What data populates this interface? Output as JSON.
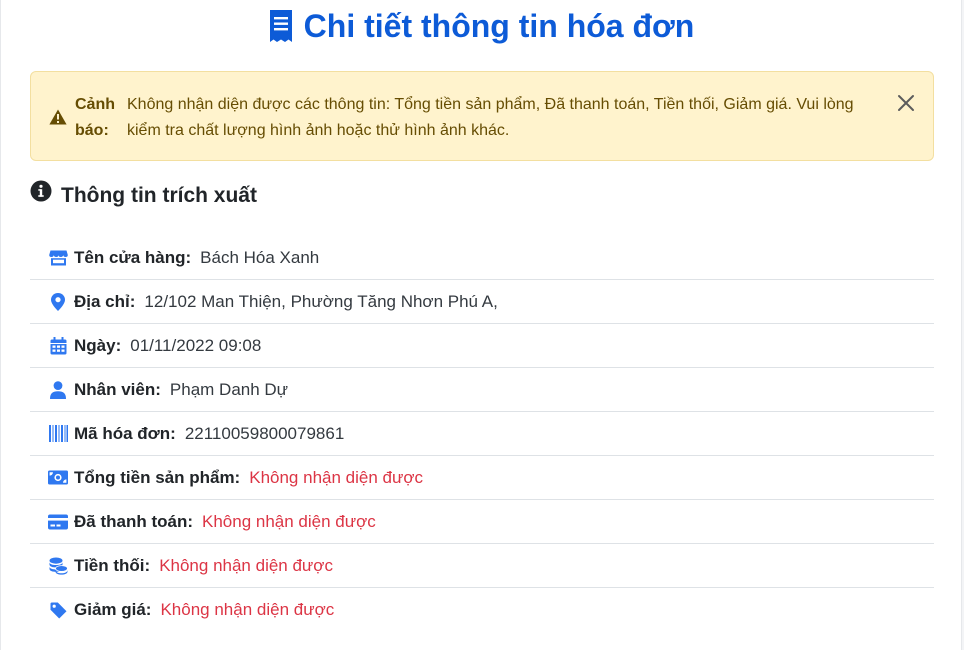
{
  "header": {
    "title": "Chi tiết thông tin hóa đơn",
    "icon": "receipt-icon"
  },
  "alert": {
    "label": "Cảnh báo:",
    "message": "Không nhận diện được các thông tin: Tổng tiền sản phẩm, Đã thanh toán, Tiền thối, Giảm giá. Vui lòng kiểm tra chất lượng hình ảnh hoặc thử hình ảnh khác.",
    "icon": "warning-triangle-icon",
    "close_icon": "close-icon"
  },
  "section": {
    "title": "Thông tin trích xuất",
    "icon": "info-circle-icon"
  },
  "fields": [
    {
      "icon": "store-icon",
      "label": "Tên cửa hàng:",
      "value": "Bách Hóa Xanh",
      "recognized": true
    },
    {
      "icon": "map-pin-icon",
      "label": "Địa chỉ:",
      "value": "12/102 Man Thiện, Phường Tăng Nhơn Phú A,",
      "recognized": true
    },
    {
      "icon": "calendar-icon",
      "label": "Ngày:",
      "value": "01/11/2022 09:08",
      "recognized": true
    },
    {
      "icon": "user-icon",
      "label": "Nhân viên:",
      "value": "Phạm Danh Dự",
      "recognized": true
    },
    {
      "icon": "barcode-icon",
      "label": "Mã hóa đơn:",
      "value": "22110059800079861",
      "recognized": true
    },
    {
      "icon": "money-bill-icon",
      "label": "Tổng tiền sản phẩm:",
      "value": "Không nhận diện được",
      "recognized": false
    },
    {
      "icon": "credit-card-icon",
      "label": "Đã thanh toán:",
      "value": "Không nhận diện được",
      "recognized": false
    },
    {
      "icon": "coins-icon",
      "label": "Tiền thối:",
      "value": "Không nhận diện được",
      "recognized": false
    },
    {
      "icon": "tag-icon",
      "label": "Giảm giá:",
      "value": "Không nhận diện được",
      "recognized": false
    }
  ],
  "colors": {
    "primary": "#0d5bd7",
    "icon_blue": "#2f78f0",
    "missing": "#dc3545",
    "alert_bg": "#fff3cd",
    "alert_text": "#664d03"
  }
}
